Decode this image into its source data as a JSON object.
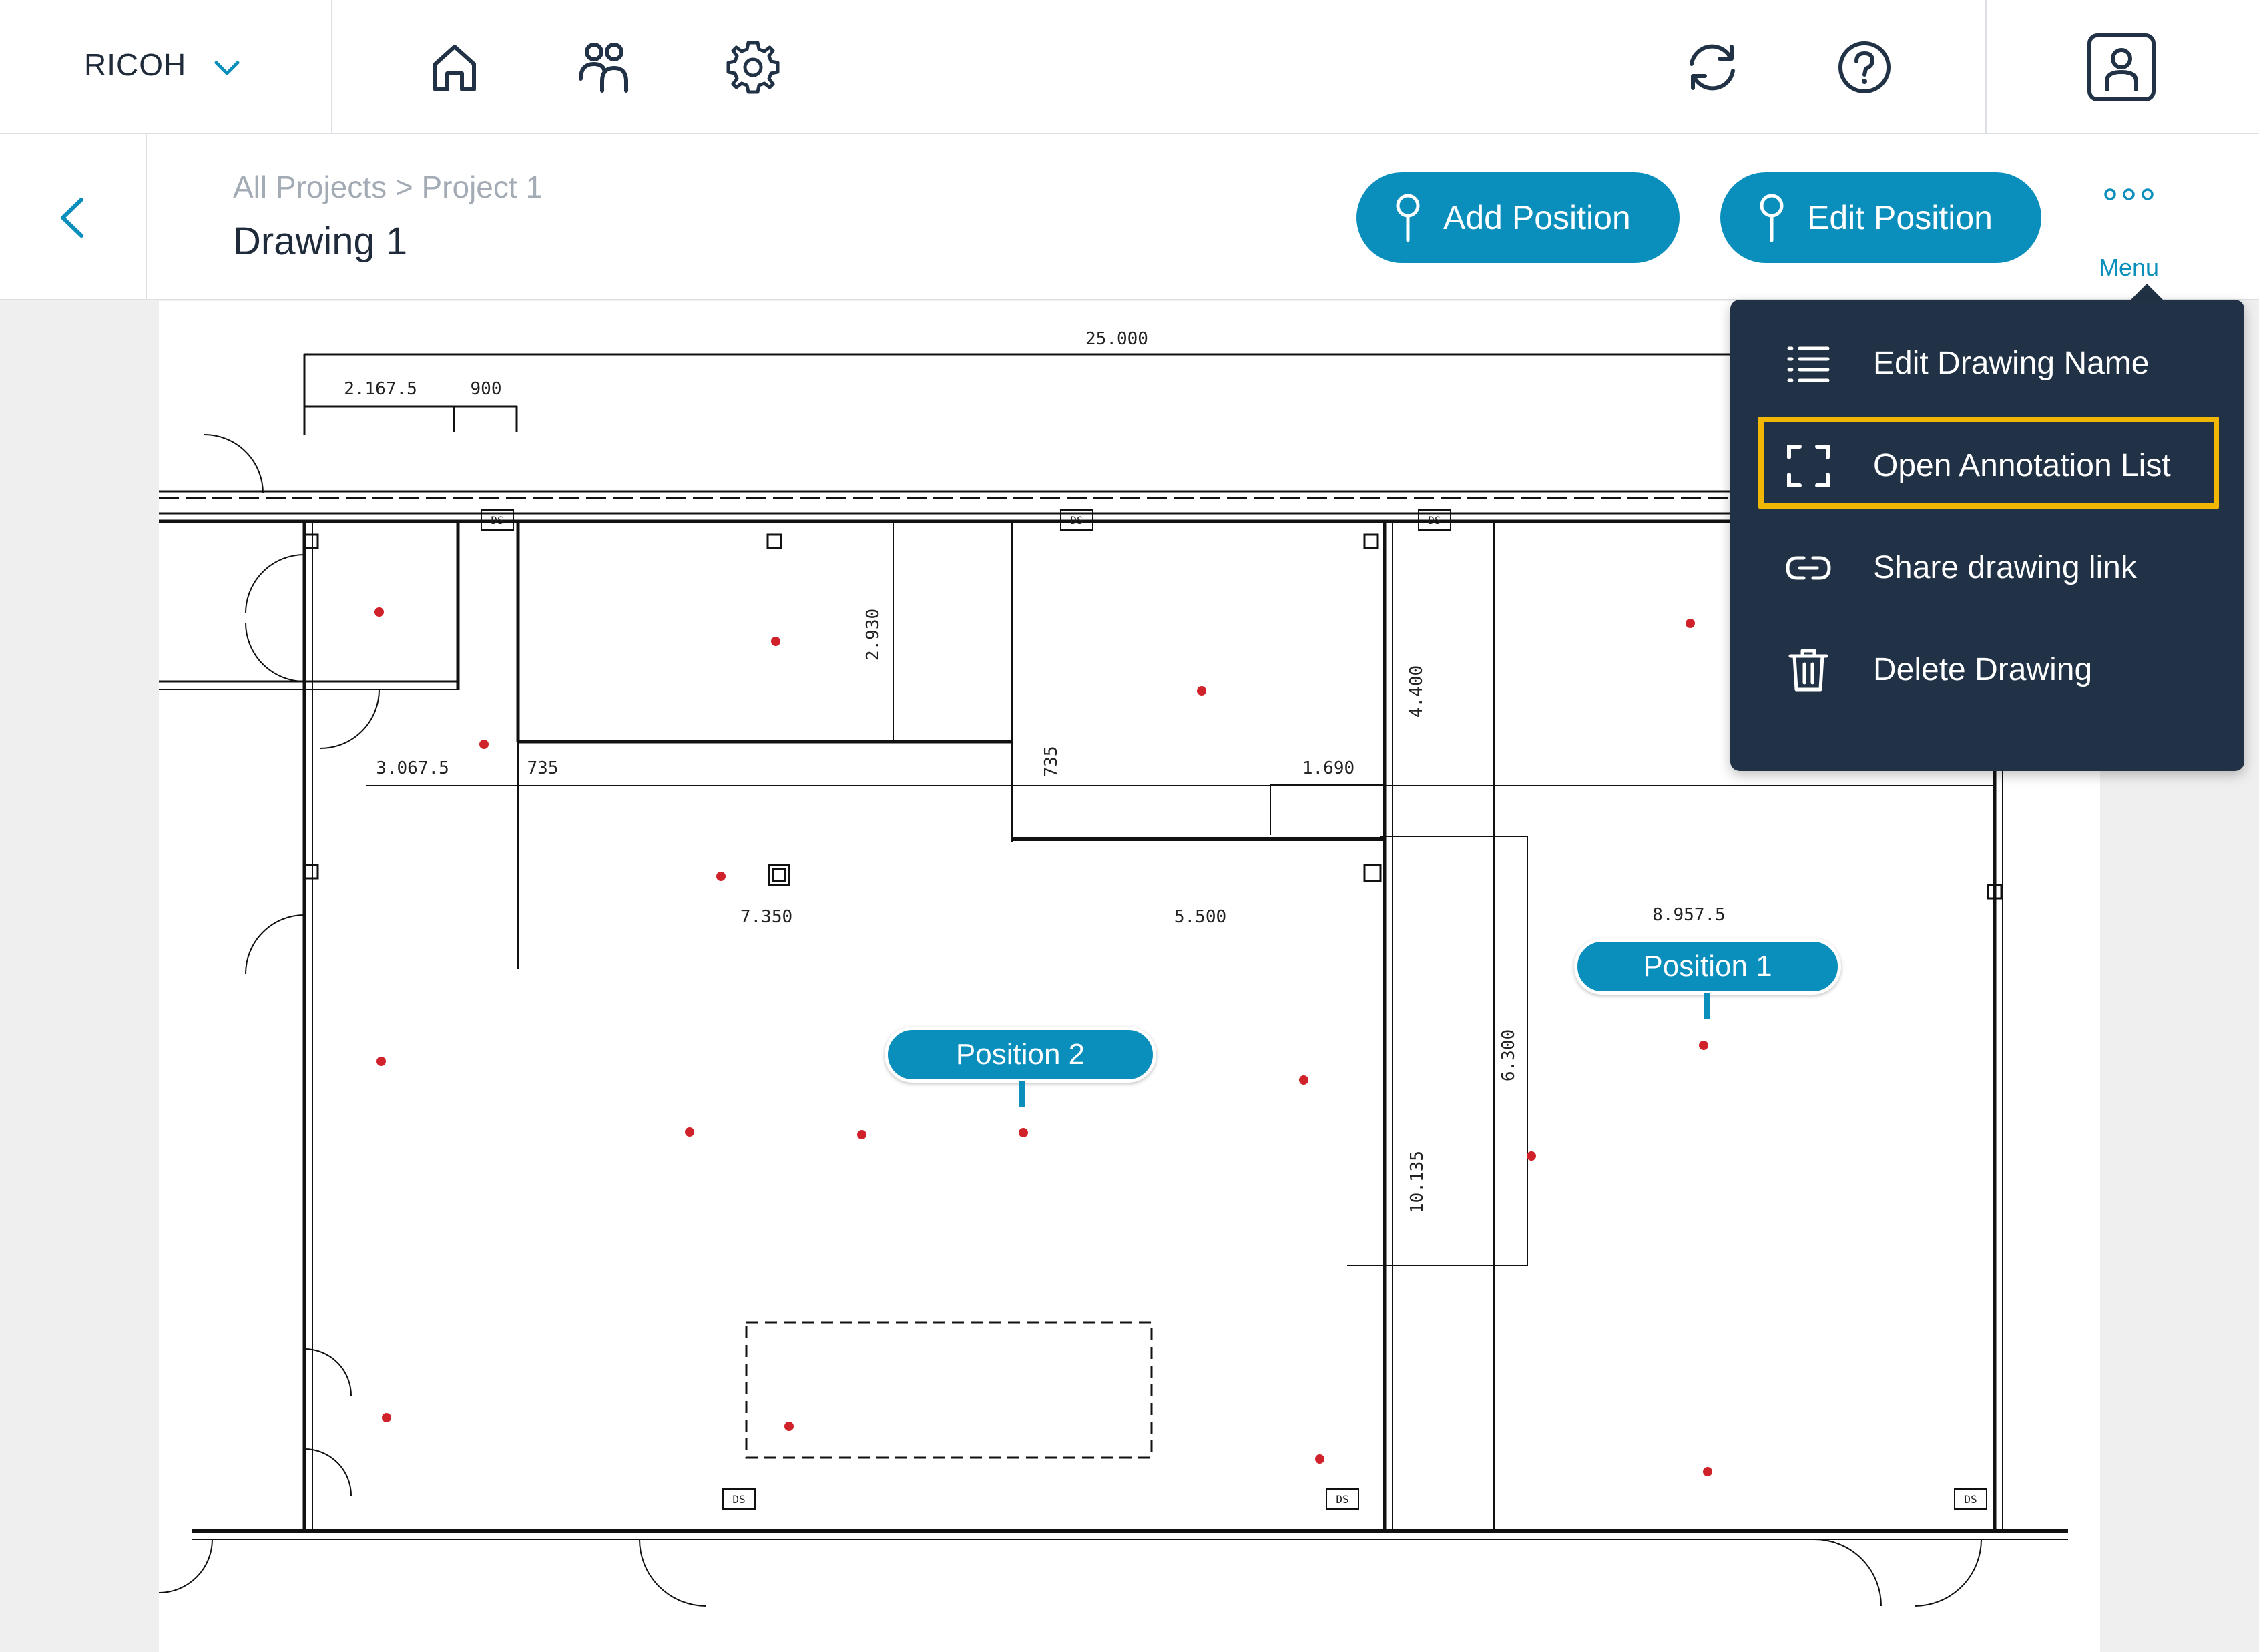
{
  "app": {
    "brand": "RICOH",
    "nav_icons": [
      "home-icon",
      "users-icon",
      "settings-icon"
    ],
    "util_icons": [
      "sync-icon",
      "help-icon",
      "profile-icon"
    ]
  },
  "header": {
    "breadcrumb": "All Projects > Project 1",
    "title": "Drawing 1",
    "add_position": "Add Position",
    "edit_position": "Edit Position",
    "menu_label": "Menu"
  },
  "dropdown": {
    "items": [
      {
        "label": "Edit Drawing Name",
        "icon": "list-icon"
      },
      {
        "label": "Open Annotation List",
        "icon": "annotation-frame-icon",
        "highlighted": true
      },
      {
        "label": "Share drawing link",
        "icon": "link-icon"
      },
      {
        "label": "Delete Drawing",
        "icon": "trash-icon"
      }
    ]
  },
  "drawing": {
    "dimensions": {
      "total_width": "25.000",
      "d1": "2.167.5",
      "d2": "900",
      "d3": "3.067.5",
      "d4": "735",
      "d5": "2.930",
      "d6": "735",
      "d7": "1.690",
      "d8": "4.400",
      "d9": "7.350",
      "d10": "5.500",
      "d11": "8.957.5",
      "d12": "6.300",
      "d13": "10.135"
    },
    "markers": [
      {
        "label": "Position 1"
      },
      {
        "label": "Position 2"
      }
    ],
    "tag": "DS"
  },
  "colors": {
    "accent": "#0a8fbd",
    "menu_bg": "#223246",
    "highlight": "#f2b705",
    "point": "#d0222a"
  }
}
